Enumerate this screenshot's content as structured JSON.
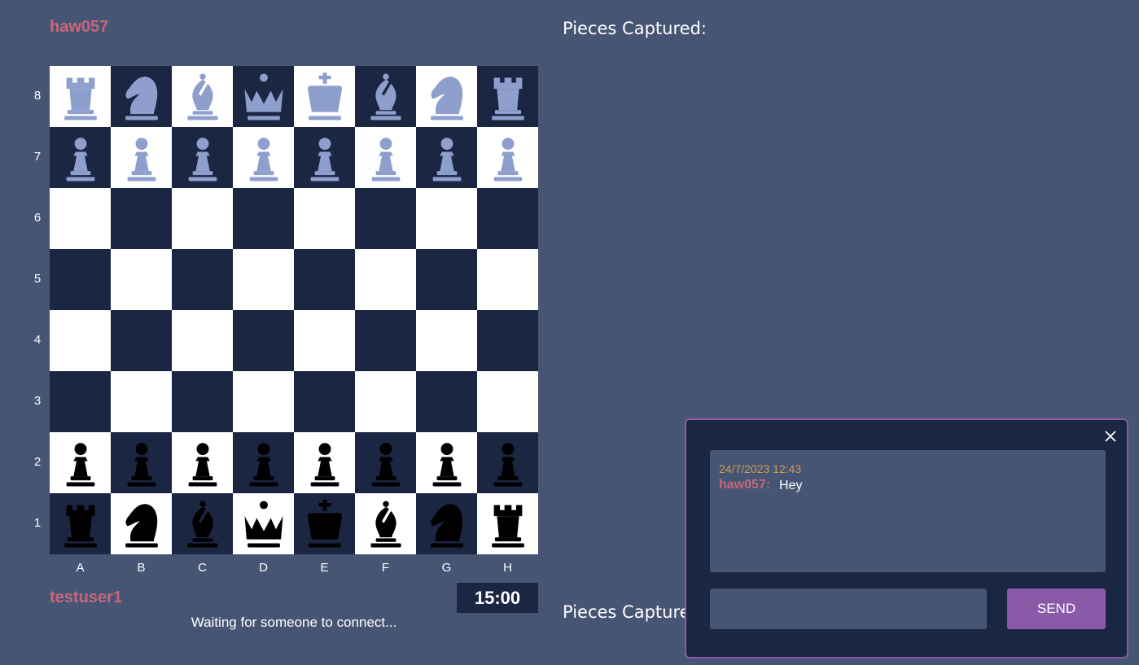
{
  "players": {
    "opponent": "haw057",
    "self": "testuser1"
  },
  "captured_label": "Pieces Captured:",
  "board": {
    "ranks": [
      "8",
      "7",
      "6",
      "5",
      "4",
      "3",
      "2",
      "1"
    ],
    "files": [
      "A",
      "B",
      "C",
      "D",
      "E",
      "F",
      "G",
      "H"
    ],
    "light_color": "#ffffff",
    "dark_color": "#1b2642",
    "white_piece_color": "#8e9fce",
    "black_piece_color": "#000000",
    "position": [
      [
        "wR",
        "wN",
        "wB",
        "wQ",
        "wK",
        "wB",
        "wN",
        "wR"
      ],
      [
        "wP",
        "wP",
        "wP",
        "wP",
        "wP",
        "wP",
        "wP",
        "wP"
      ],
      [
        "",
        "",
        "",
        "",
        "",
        "",
        "",
        ""
      ],
      [
        "",
        "",
        "",
        "",
        "",
        "",
        "",
        ""
      ],
      [
        "",
        "",
        "",
        "",
        "",
        "",
        "",
        ""
      ],
      [
        "",
        "",
        "",
        "",
        "",
        "",
        "",
        ""
      ],
      [
        "bP",
        "bP",
        "bP",
        "bP",
        "bP",
        "bP",
        "bP",
        "bP"
      ],
      [
        "bR",
        "bN",
        "bB",
        "bQ",
        "bK",
        "bB",
        "bN",
        "bR"
      ]
    ]
  },
  "timer": "15:00",
  "status": "Waiting for someone to connect...",
  "chat": {
    "close_icon": "close-icon",
    "messages": [
      {
        "time": "24/7/2023 12:43",
        "author": "haw057:",
        "text": "Hey"
      }
    ],
    "input_value": "",
    "send_label": "SEND"
  }
}
